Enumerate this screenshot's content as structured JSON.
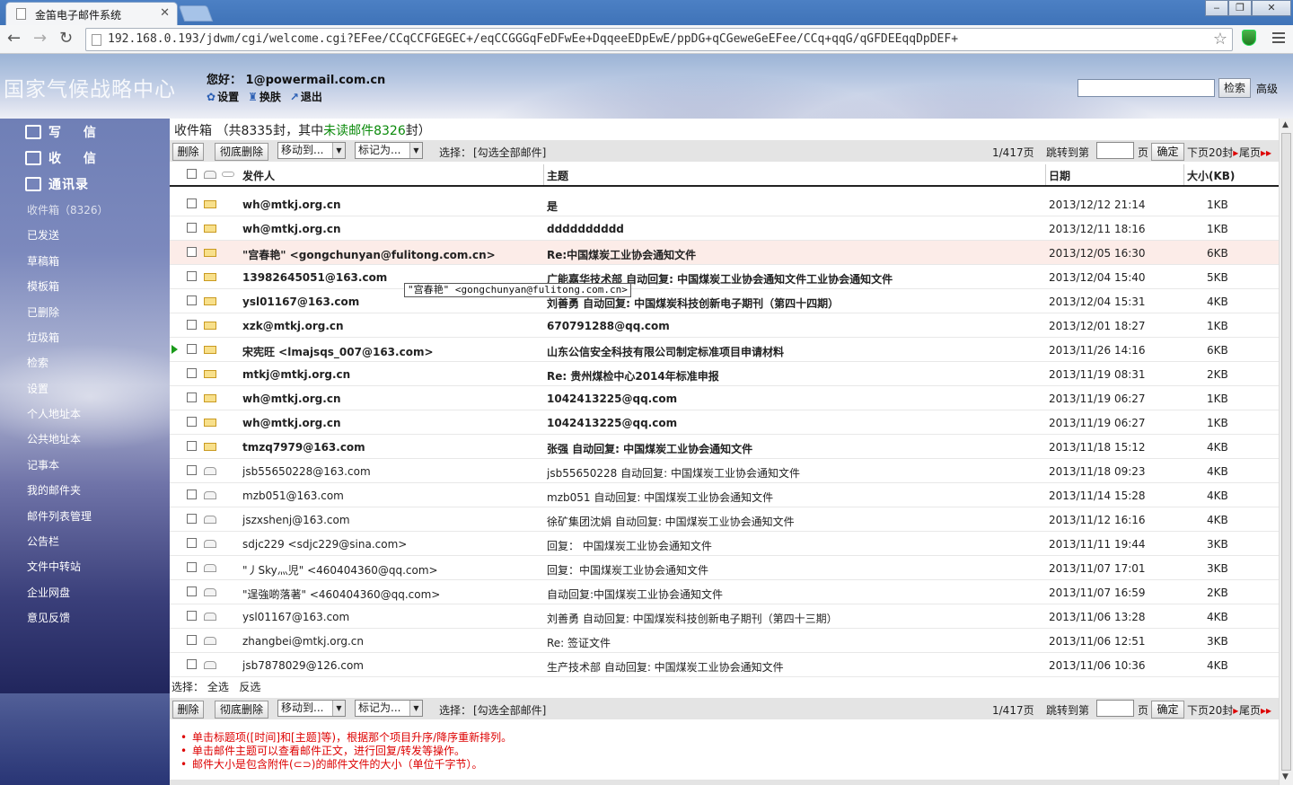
{
  "browser": {
    "tab_title": "金笛电子邮件系统",
    "url": "192.168.0.193/jdwm/cgi/welcome.cgi?EFee/CCqCCFGEGEC+/eqCCGGGqFeDFwEe+DqqeeEDpEwE/ppDG+qCGeweGeEFee/CCq+qqG/qGFDEEqqDpDEF+"
  },
  "header": {
    "logo_text": "国家气候战略中心",
    "greeting": "您好： 1@powermail.com.cn",
    "links": [
      "设置",
      "换肤",
      "退出"
    ],
    "search_button": "检索",
    "advanced": "高级"
  },
  "sidebar": {
    "main_nav": [
      "写 信",
      "收 信",
      "通讯录"
    ],
    "items": [
      "收件箱（8326）",
      "已发送",
      "草稿箱",
      "模板箱",
      "已删除",
      "垃圾箱",
      "检索",
      "设置",
      "个人地址本",
      "公共地址本",
      "记事本",
      "我的邮件夹",
      "邮件列表管理",
      "公告栏",
      "文件中转站",
      "企业网盘",
      "意见反馈"
    ]
  },
  "inbox": {
    "title_prefix": "收件箱 （共8335封，其中",
    "unread_text": "未读邮件8326",
    "title_suffix": "封）",
    "actions": {
      "delete": "删除",
      "purge": "彻底删除",
      "move_to": "移动到...",
      "mark_as": "标记为...",
      "select_label": "选择：",
      "select_all_link": "[勾选全部邮件]",
      "page_info": "1/417页",
      "jump_label": "跳转到第",
      "page_unit": "页",
      "confirm": "确定",
      "next_label": "下页20封",
      "last_label": "尾页"
    },
    "columns": {
      "from": "发件人",
      "subject": "主题",
      "date": "日期",
      "size": "大小(KB)"
    },
    "tooltip": "\"宫春艳\" <gongchunyan@fulitong.com.cn>",
    "bottom_select": {
      "label": "选择：",
      "all": "全选",
      "invert": "反选"
    },
    "notes": [
      "单击标题项([时间]和[主题]等)，根据那个项目升序/降序重新排列。",
      "单击邮件主题可以查看邮件正文，进行回复/转发等操作。",
      "邮件大小是包含附件(⊂⊃)的邮件文件的大小（单位千字节）。"
    ],
    "emails": [
      {
        "from": "wh@mtkj.org.cn",
        "subject": "是",
        "date": "2013/12/12 21:14",
        "size": "1KB",
        "unread": true
      },
      {
        "from": "wh@mtkj.org.cn",
        "subject": "dddddddddd",
        "date": "2013/12/11 18:16",
        "size": "1KB",
        "unread": true
      },
      {
        "from": "\"宫春艳\" <gongchunyan@fulitong.com.cn>",
        "subject": "Re:中国煤炭工业协会通知文件",
        "date": "2013/12/05 16:30",
        "size": "6KB",
        "unread": true,
        "highlight": true
      },
      {
        "from": "13982645051@163.com",
        "subject": "广能嘉华技术部 自动回复: 中国煤炭工业协会通知文件工业协会通知文件",
        "date": "2013/12/04 15:40",
        "size": "5KB",
        "unread": true
      },
      {
        "from": "ysl01167@163.com",
        "subject": "刘善勇 自动回复: 中国煤炭科技创新电子期刊（第四十四期）",
        "date": "2013/12/04 15:31",
        "size": "4KB",
        "unread": true
      },
      {
        "from": "xzk@mtkj.org.cn",
        "subject": "670791288@qq.com",
        "date": "2013/12/01 18:27",
        "size": "1KB",
        "unread": true
      },
      {
        "from": "宋宪旺 <lmajsqs_007@163.com>",
        "subject": "山东公信安全科技有限公司制定标准项目申请材料",
        "date": "2013/11/26 14:16",
        "size": "6KB",
        "unread": true,
        "marked": true
      },
      {
        "from": "mtkj@mtkj.org.cn",
        "subject": "Re: 贵州煤检中心2014年标准申报",
        "date": "2013/11/19 08:31",
        "size": "2KB",
        "unread": true
      },
      {
        "from": "wh@mtkj.org.cn",
        "subject": "1042413225@qq.com",
        "date": "2013/11/19 06:27",
        "size": "1KB",
        "unread": true
      },
      {
        "from": "wh@mtkj.org.cn",
        "subject": "1042413225@qq.com",
        "date": "2013/11/19 06:27",
        "size": "1KB",
        "unread": true
      },
      {
        "from": "tmzq7979@163.com",
        "subject": "张强 自动回复: 中国煤炭工业协会通知文件",
        "date": "2013/11/18 15:12",
        "size": "4KB",
        "unread": true
      },
      {
        "from": "jsb55650228@163.com",
        "subject": "jsb55650228 自动回复: 中国煤炭工业协会通知文件",
        "date": "2013/11/18 09:23",
        "size": "4KB",
        "unread": false
      },
      {
        "from": "mzb051@163.com",
        "subject": "mzb051 自动回复: 中国煤炭工业协会通知文件",
        "date": "2013/11/14 15:28",
        "size": "4KB",
        "unread": false
      },
      {
        "from": "jszxshenj@163.com",
        "subject": "徐矿集团沈娟 自动回复: 中国煤炭工业协会通知文件",
        "date": "2013/11/12 16:16",
        "size": "4KB",
        "unread": false
      },
      {
        "from": "sdjc229 <sdjc229@sina.com>",
        "subject": "回复： 中国煤炭工业协会通知文件",
        "date": "2013/11/11 19:44",
        "size": "3KB",
        "unread": false
      },
      {
        "from": "\"丿Sky灬児\" <460404360@qq.com>",
        "subject": "回复：中国煤炭工业协会通知文件",
        "date": "2013/11/07 17:01",
        "size": "3KB",
        "unread": false
      },
      {
        "from": "\"逞強啲落著\" <460404360@qq.com>",
        "subject": "自动回复:中国煤炭工业协会通知文件",
        "date": "2013/11/07 16:59",
        "size": "2KB",
        "unread": false
      },
      {
        "from": "ysl01167@163.com",
        "subject": "刘善勇 自动回复: 中国煤炭科技创新电子期刊（第四十三期）",
        "date": "2013/11/06 13:28",
        "size": "4KB",
        "unread": false
      },
      {
        "from": "zhangbei@mtkj.org.cn",
        "subject": "Re: 签证文件",
        "date": "2013/11/06 12:51",
        "size": "3KB",
        "unread": false
      },
      {
        "from": "jsb7878029@126.com",
        "subject": "生产技术部 自动回复: 中国煤炭工业协会通知文件",
        "date": "2013/11/06 10:36",
        "size": "4KB",
        "unread": false
      }
    ]
  }
}
